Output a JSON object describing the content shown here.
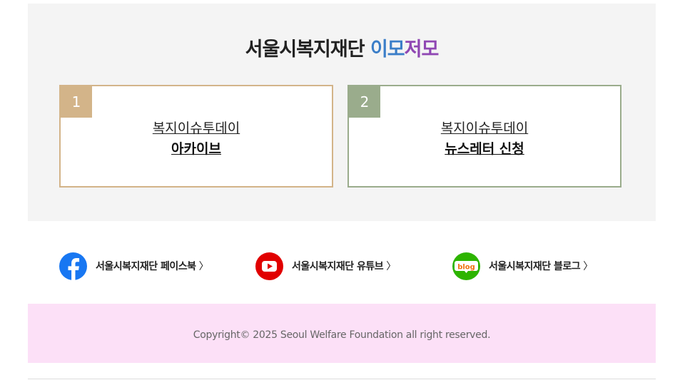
{
  "header": {
    "title_main": "서울시복지재단",
    "title_part1": "이모",
    "title_part2": "저모",
    "colors": {
      "part1": "#3b7ec8",
      "part2": "#8f47b3"
    }
  },
  "cards": [
    {
      "number": "1",
      "line1": "복지이슈투데이",
      "line2": "아카이브",
      "color": "#d3b489"
    },
    {
      "number": "2",
      "line1": "복지이슈투데이",
      "line2": "뉴스레터 신청",
      "color": "#9aac8c"
    }
  ],
  "social": [
    {
      "label": "서울시복지재단 페이스북",
      "icon": "facebook-icon"
    },
    {
      "label": "서울시복지재단 유튜브",
      "icon": "youtube-icon"
    },
    {
      "label": "서울시복지재단 블로그",
      "icon": "blog-icon",
      "icon_text": "blog"
    }
  ],
  "chevron": "〉",
  "footer": {
    "copyright": "Copyright© 2025 Seoul Welfare Foundation all right reserved."
  }
}
